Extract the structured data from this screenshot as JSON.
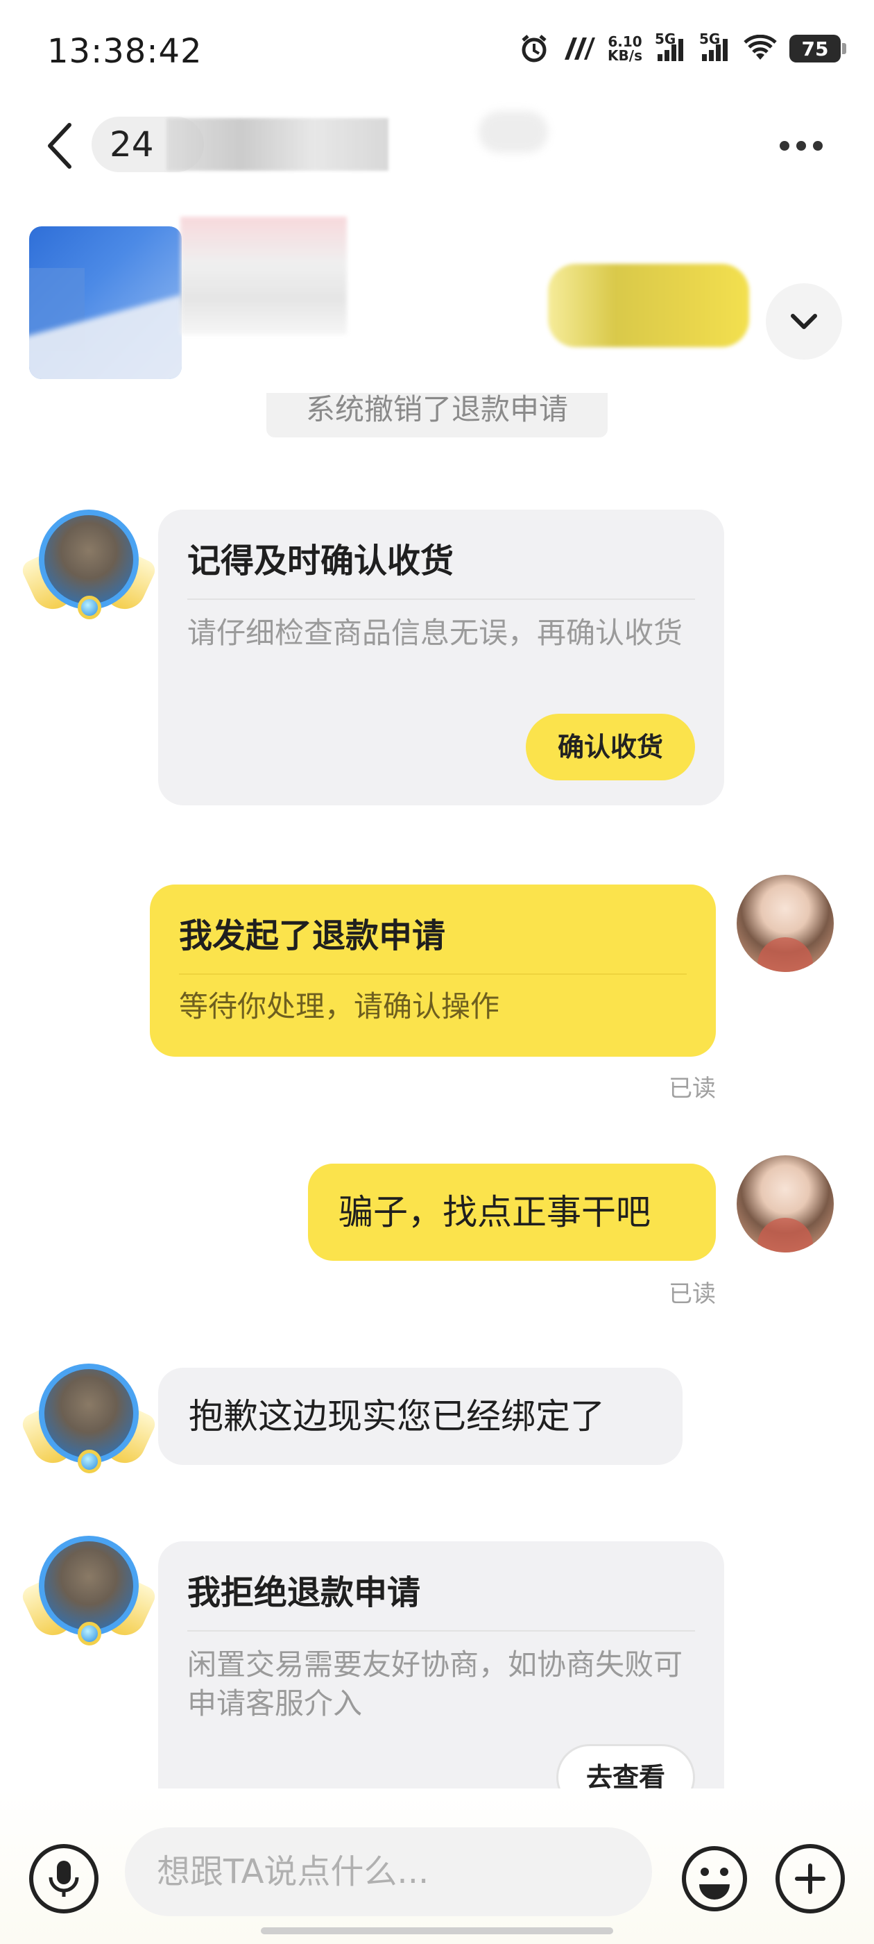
{
  "status_bar": {
    "time": "13:38:42",
    "net_speed_value": "6.10",
    "net_speed_unit": "KB/s",
    "signal1_label": "5G",
    "signal2_label": "5G",
    "battery": "75"
  },
  "header": {
    "contact_prefix": "24"
  },
  "chat": {
    "system_notice": "系统撤销了退款申请",
    "card_confirm": {
      "title": "记得及时确认收货",
      "desc": "请仔细检查商品信息无误，再确认收货",
      "button": "确认收货"
    },
    "card_refund_request": {
      "title": "我发起了退款申请",
      "desc": "等待你处理，请确认操作",
      "read": "已读"
    },
    "msg_me": {
      "text": "骗子，找点正事干吧",
      "read": "已读"
    },
    "msg_seller": {
      "text": "抱歉这边现实您已经绑定了"
    },
    "card_refund_reject": {
      "title": "我拒绝退款申请",
      "desc": "闲置交易需要友好协商，如协商失败可申请客服介入",
      "button": "去查看"
    }
  },
  "input_bar": {
    "placeholder": "想跟TA说点什么..."
  },
  "colors": {
    "accent_yellow": "#fbe34c",
    "bubble_gray": "#f1f1f3",
    "text_secondary": "#9a9a9a"
  },
  "icons": {
    "back": "chevron-left-icon",
    "more": "more-dots-icon",
    "expand": "chevron-down-icon",
    "voice": "microphone-icon",
    "emoji": "smiley-icon",
    "add": "plus-icon"
  }
}
